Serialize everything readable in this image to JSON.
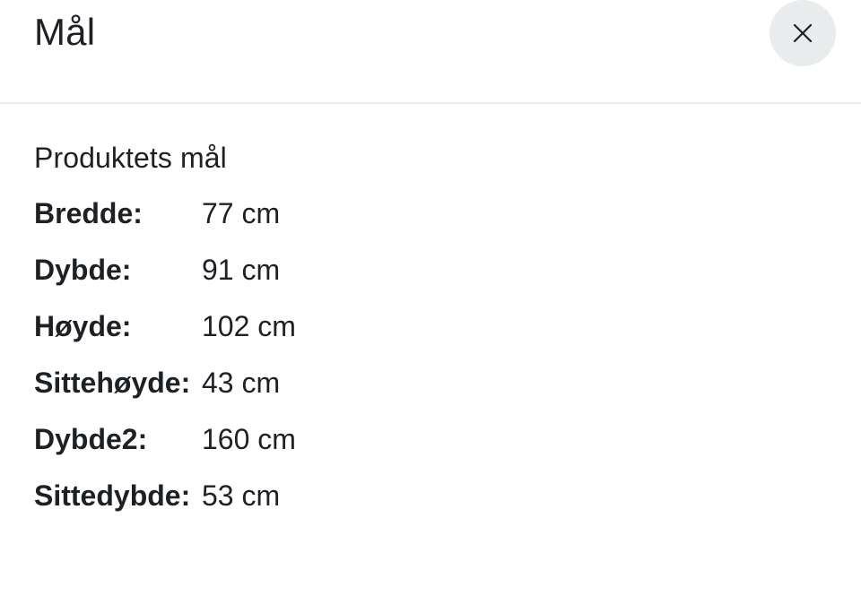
{
  "modal": {
    "title": "Mål",
    "close_icon": "close-icon"
  },
  "section": {
    "title": "Produktets mål"
  },
  "dimensions": [
    {
      "label": "Bredde:",
      "value": "77 cm"
    },
    {
      "label": "Dybde:",
      "value": "91 cm"
    },
    {
      "label": "Høyde:",
      "value": "102 cm"
    },
    {
      "label": "Sittehøyde:",
      "value": "43 cm"
    },
    {
      "label": "Dybde2:",
      "value": "160 cm"
    },
    {
      "label": "Sittedybde:",
      "value": "53 cm"
    }
  ],
  "colors": {
    "text": "#1d2024",
    "close_button_bg": "#e9eced",
    "divider": "#e8eced",
    "background": "#ffffff"
  }
}
